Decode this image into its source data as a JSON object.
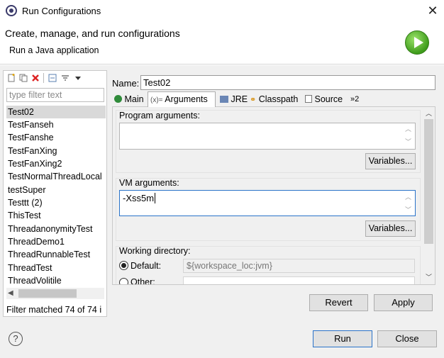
{
  "window": {
    "title": "Run Configurations",
    "close_label": "✕"
  },
  "header": {
    "title": "Create, manage, and run configurations",
    "subtitle": "Run a Java application"
  },
  "left": {
    "filter_placeholder": "type filter text",
    "items": [
      "Test02",
      "TestFanseh",
      "TestFanshe",
      "TestFanXing",
      "TestFanXing2",
      "TestNormalThreadLocal",
      "testSuper",
      "Testtt (2)",
      "ThisTest",
      "ThreadanonymityTest",
      "ThreadDemo1",
      "ThreadRunnableTest",
      "ThreadTest",
      "ThreadVolitile"
    ],
    "selected": "Test02",
    "status": "Filter matched 74 of 74 i"
  },
  "name": {
    "label": "Name:",
    "value": "Test02"
  },
  "tabs": [
    {
      "label": "Main",
      "icon": "main-tab-icon"
    },
    {
      "label": "Arguments",
      "icon": "arguments-tab-icon"
    },
    {
      "label": "JRE",
      "icon": "jre-tab-icon"
    },
    {
      "label": "Classpath",
      "icon": "classpath-tab-icon"
    },
    {
      "label": "Source",
      "icon": "source-tab-icon"
    },
    {
      "label": "»2",
      "icon": "more-tabs-icon"
    }
  ],
  "program_args": {
    "label": "Program arguments:",
    "value": "",
    "variables_label": "Variables..."
  },
  "vm_args": {
    "label": "VM arguments:",
    "value": "-Xss5m",
    "variables_label": "Variables..."
  },
  "working_dir": {
    "label": "Working directory:",
    "default_label": "Default:",
    "default_value": "${workspace_loc:jvm}",
    "other_label": "Other:"
  },
  "buttons": {
    "revert": "Revert",
    "apply": "Apply",
    "run": "Run",
    "close": "Close"
  },
  "colors": {
    "focus_border": "#2a73c9",
    "selection": "#d9d9d9",
    "run_badge": "#3f9c1c"
  }
}
